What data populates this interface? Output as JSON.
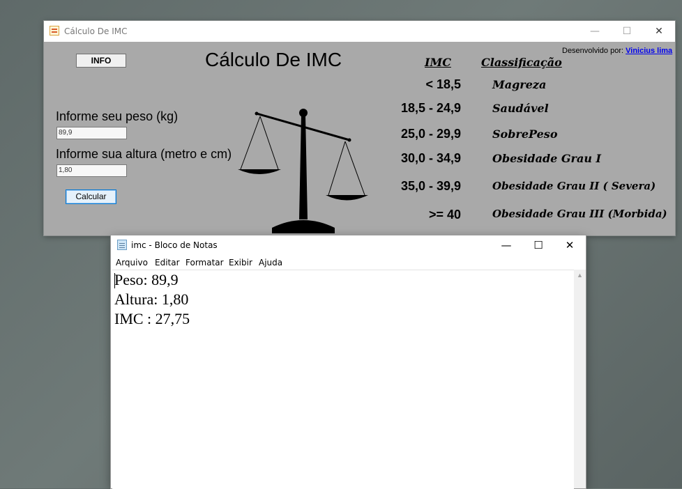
{
  "imc_window": {
    "title": "Cálculo De IMC",
    "minimize": "—",
    "maximize": "☐",
    "close": "✕",
    "info_button": "INFO",
    "heading": "Cálculo De IMC",
    "peso_label": "Informe seu peso (kg)",
    "peso_value": "89,9",
    "altura_label": "Informe sua altura (metro e cm)",
    "altura_value": "1,80",
    "calc_button": "Calcular",
    "developer_label": "Desenvolvido por:",
    "developer_link": "Vinicius lima",
    "table_header_imc": "IMC",
    "table_header_class": "Classificação",
    "ranges": [
      "< 18,5",
      "18,5 - 24,9",
      "25,0 - 29,9",
      "30,0 - 34,9",
      "35,0 - 39,9",
      ">= 40"
    ],
    "classifications": [
      "Magreza",
      "Saudável",
      "SobrePeso",
      "Obesidade Grau I",
      "Obesidade Grau II ( Severa)",
      "Obesidade Grau III (Morbida)"
    ]
  },
  "notepad": {
    "title": "imc - Bloco de Notas",
    "minimize": "—",
    "maximize": "☐",
    "close": "✕",
    "menu": [
      "Arquivo",
      "Editar",
      "Formatar",
      "Exibir",
      "Ajuda"
    ],
    "lines": [
      "Peso: 89,9",
      "Altura: 1,80",
      "IMC : 27,75"
    ],
    "scroll_up": "▲"
  }
}
